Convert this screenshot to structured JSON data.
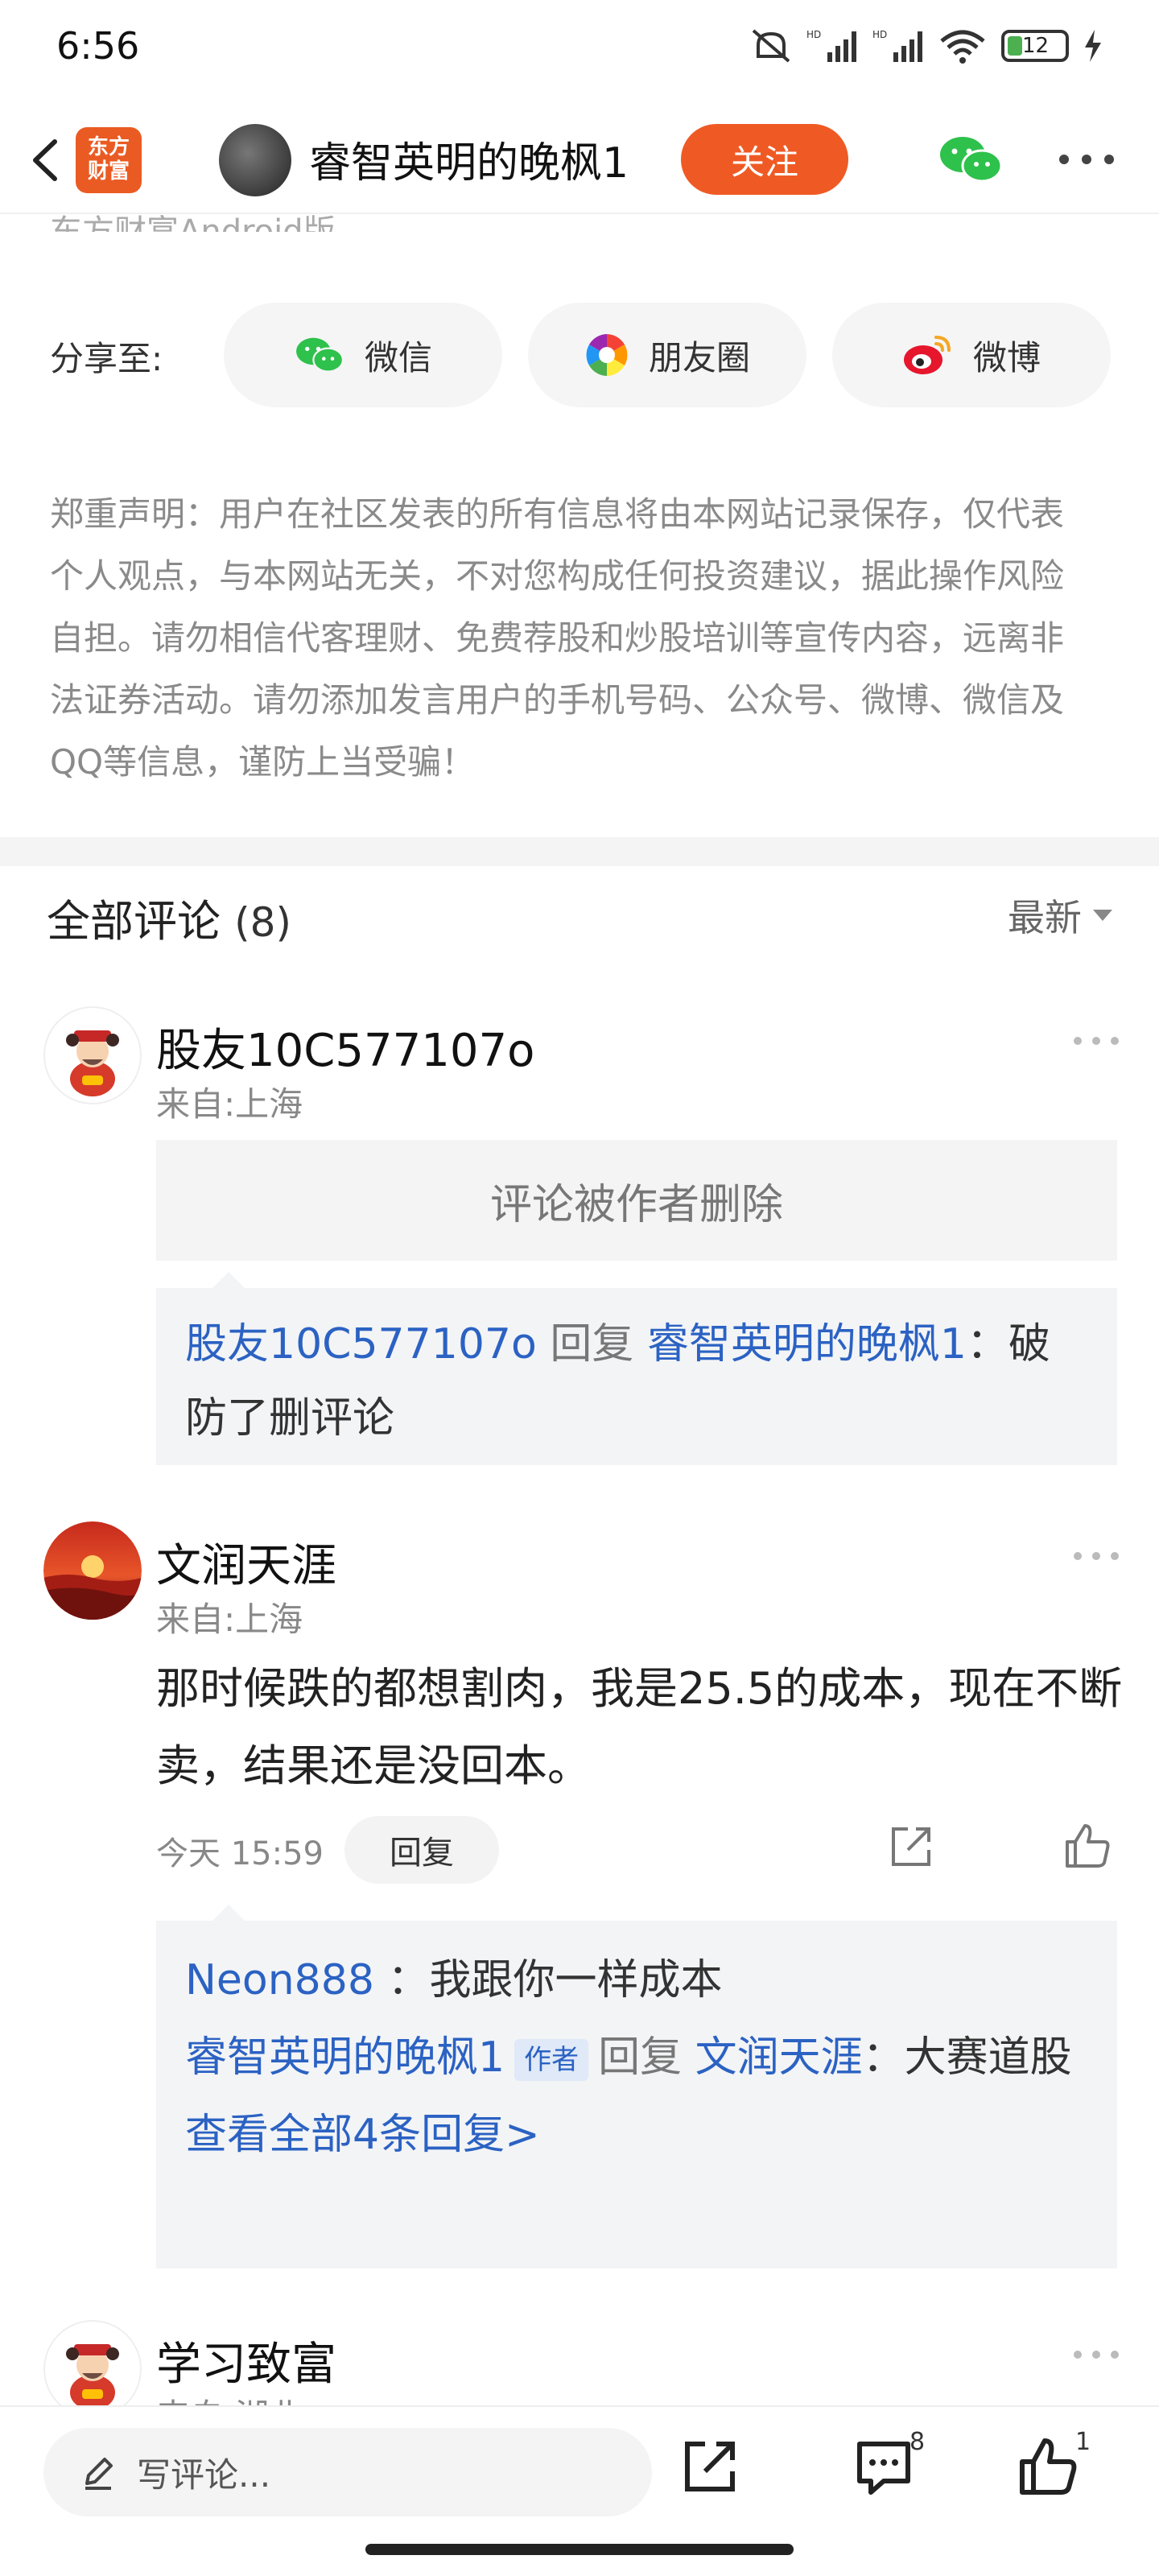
{
  "status_bar": {
    "time": "6:56",
    "battery": "12"
  },
  "header": {
    "logo_text": "东方\n财富",
    "title": "睿智英明的晚枫1",
    "follow_label": "关注"
  },
  "partial_text": "东方财富Android版",
  "share": {
    "label": "分享至:",
    "options": [
      {
        "label": "微信",
        "icon": "wechat-icon"
      },
      {
        "label": "朋友圈",
        "icon": "moments-icon"
      },
      {
        "label": "微博",
        "icon": "weibo-icon"
      }
    ]
  },
  "disclaimer": "郑重声明：用户在社区发表的所有信息将由本网站记录保存，仅代表个人观点，与本网站无关，不对您构成任何投资建议，据此操作风险自担。请勿相信代客理财、免费荐股和炒股培训等宣传内容，远离非法证券活动。请勿添加发言用户的手机号码、公众号、微博、微信及QQ等信息，谨防上当受骗！",
  "comments_header": {
    "title": "全部评论",
    "count": "(8)",
    "sort": "最新"
  },
  "comments": [
    {
      "name": "股友10C577107o",
      "location": "来自:上海",
      "deleted_text": "评论被作者删除",
      "reply": {
        "from": "股友10C577107o",
        "verb": "回复",
        "to": "睿智英明的晚枫1",
        "text": "：破防了删评论"
      }
    },
    {
      "name": "文润天涯",
      "location": "来自:上海",
      "text": "那时候跌的都想割肉，我是25.5的成本，现在不断卖，结果还是没回本。",
      "time": "今天 15:59",
      "reply_label": "回复",
      "replies": [
        {
          "from": "Neon888",
          "text": "：我跟你一样成本"
        },
        {
          "from": "睿智英明的晚枫1",
          "tag": "作者",
          "verb": "回复",
          "to": "文润天涯",
          "text": "：大赛道股"
        }
      ],
      "view_all": "查看全部4条回复>"
    },
    {
      "name": "学习致富",
      "location": "来自:湖北"
    }
  ],
  "bottom_bar": {
    "write_placeholder": "写评论...",
    "comment_count": "8",
    "like_count": "1"
  }
}
